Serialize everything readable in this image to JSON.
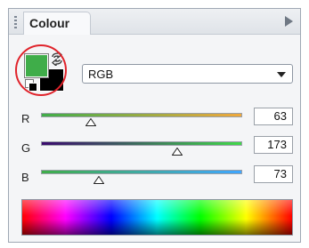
{
  "panel": {
    "title": "Colour"
  },
  "swatches": {
    "foreground_color": "#3fad49",
    "background_color": "#000000"
  },
  "color_model": {
    "selected": "RGB"
  },
  "channels": [
    {
      "label": "R",
      "value": "63"
    },
    {
      "label": "G",
      "value": "173"
    },
    {
      "label": "B",
      "value": "73"
    }
  ],
  "colors": {
    "accent_highlight": "#e0232b",
    "r_track_start": "#3fad49",
    "r_track_end": "#f0a83c",
    "g_track_start": "#3a0a6e",
    "g_track_end": "#40d94a",
    "b_track_start": "#3fad49",
    "b_track_end": "#3fa6ff"
  }
}
